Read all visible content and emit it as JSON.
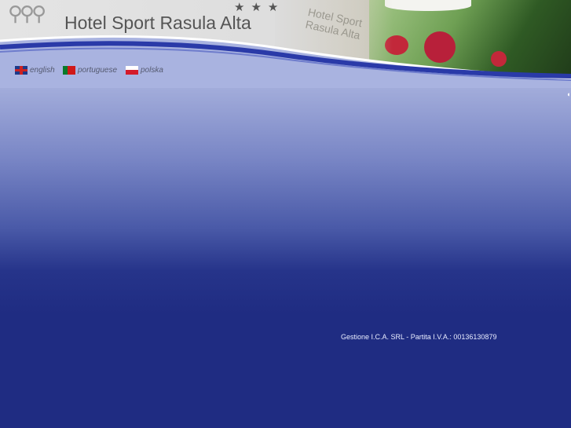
{
  "header": {
    "title": "Hotel Sport Rasula Alta",
    "stars": "★★★",
    "watermark": "Hotel Sport Rasula Alta"
  },
  "languages": [
    {
      "label": "english",
      "flag": "uk-flag-icon"
    },
    {
      "label": "portuguese",
      "flag": "portugal-flag-icon"
    },
    {
      "label": "polska",
      "flag": "poland-flag-icon"
    }
  ],
  "footer": {
    "text": "Gestione I.C.A. SRL - Partita I.V.A.: 00136130879"
  },
  "colors": {
    "background_top": "#a9b3e0",
    "background_bottom": "#1f2c82",
    "wave": "#2a3aa8"
  }
}
